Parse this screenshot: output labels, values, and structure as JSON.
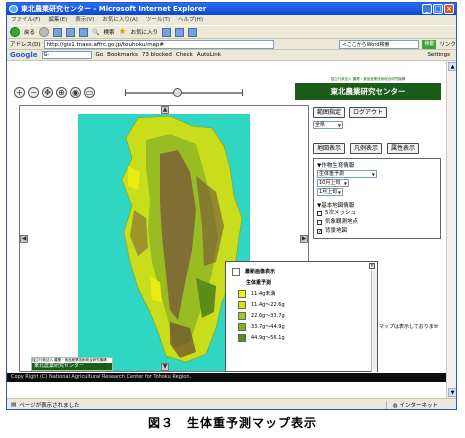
{
  "window": {
    "title": "東北農業研究センター - Microsoft Internet Explorer"
  },
  "menubar": {
    "items": [
      "ファイル(F)",
      "編集(E)",
      "表示(V)",
      "お気に入り(A)",
      "ツール(T)",
      "ヘルプ(H)"
    ]
  },
  "toolbar": {
    "back": "戻る",
    "search": "検索",
    "favorites": "お気に入り"
  },
  "addressbar": {
    "label": "アドレス(D)",
    "url": "http://gis1.tnaes.affrc.go.jp/touhoku/map#",
    "search_placeholder": "<ここからWord検索",
    "go": "移動",
    "links": "リンク"
  },
  "googlebar": {
    "logo": "Google",
    "input": "G-",
    "go": "Go",
    "bookmarks": "Bookmarks",
    "blocked": "73 blocked",
    "check": "Check",
    "autolink": "AutoLink",
    "settings": "Settings"
  },
  "site": {
    "org": "独立行政法人 農業・食品産業技術総合研究機構",
    "title": "東北農業研究センター"
  },
  "panel": {
    "btn_extent": "範囲指定",
    "btn_login": "ログアウト",
    "region": "全県",
    "btn_map": "地図表示",
    "btn_legend": "凡例表示",
    "btn_attr": "属性表示",
    "crop_header": "▼作物生育情報",
    "crop_type": "生体重予測",
    "month": "10月上旬",
    "period": "1月上旬",
    "base_header": "▼基本地図情報",
    "checks": [
      {
        "label": "5次メッシュ",
        "checked": false
      },
      {
        "label": "気象観測地点",
        "checked": false
      },
      {
        "label": "背景地図",
        "checked": true
      }
    ]
  },
  "legend": {
    "title": "最新画像表示",
    "subtitle": "生体重予測",
    "items": [
      {
        "label": "11.4g未満",
        "color": "#f4f20a"
      },
      {
        "label": "11.4g～22.6g",
        "color": "#d6e40c"
      },
      {
        "label": "22.6g～33.7g",
        "color": "#a8c818"
      },
      {
        "label": "33.7g～44.9g",
        "color": "#7fae1f"
      },
      {
        "label": "44.9g～56.1g",
        "color": "#5c8c1c"
      }
    ]
  },
  "behind_text": "マップは表示しておりませ",
  "bottom_logo": {
    "org": "独立行政法人 農業・食品産業技術総合研究機構",
    "title": "東北農業研究センター"
  },
  "copyright": "Copy Right (C) National Agricultural Research Center for Tohoku Region.",
  "statusbar": {
    "text": "ページが表示されました",
    "zone": "インターネット"
  },
  "caption": "図３　生体重予測マップ表示"
}
